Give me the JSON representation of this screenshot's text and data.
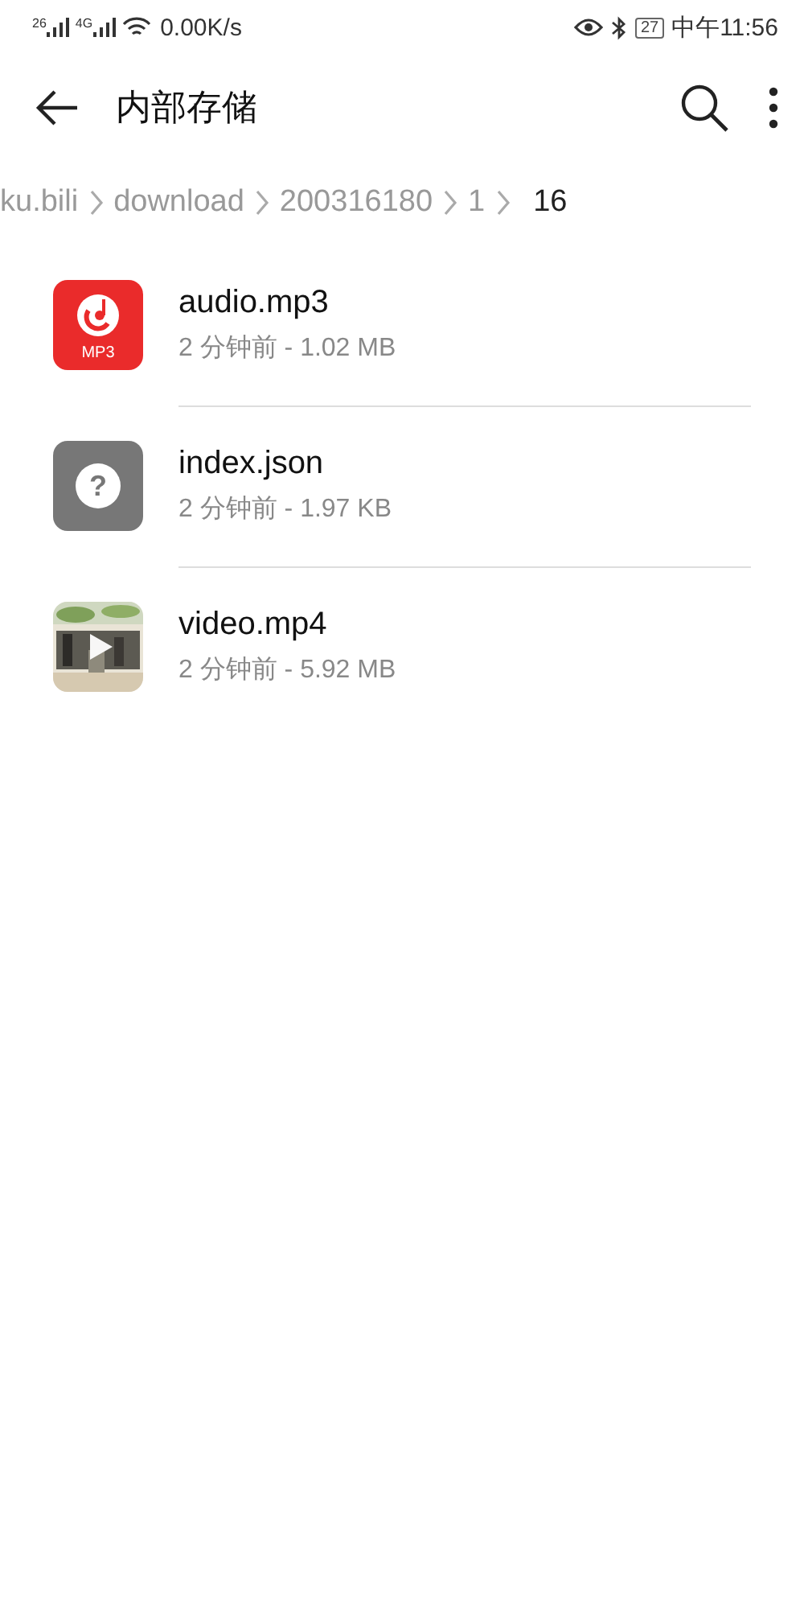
{
  "status_bar": {
    "sim1_label": "26",
    "sim2_label": "4G",
    "speed": "0.00K/s",
    "battery": "27",
    "time": "中午11:56"
  },
  "app_bar": {
    "title": "内部存储"
  },
  "breadcrumbs": [
    {
      "label": "ku.bili",
      "selected": false
    },
    {
      "label": "download",
      "selected": false
    },
    {
      "label": "200316180",
      "selected": false
    },
    {
      "label": "1",
      "selected": false
    },
    {
      "label": "16",
      "selected": true
    }
  ],
  "files": [
    {
      "kind": "audio",
      "name": "audio.mp3",
      "details": "2 分钟前 - 1.02 MB",
      "icon_label": "MP3"
    },
    {
      "kind": "unknown",
      "name": "index.json",
      "details": "2 分钟前 - 1.97 KB",
      "icon_label": "?"
    },
    {
      "kind": "video",
      "name": "video.mp4",
      "details": "2 分钟前 - 5.92 MB"
    }
  ]
}
